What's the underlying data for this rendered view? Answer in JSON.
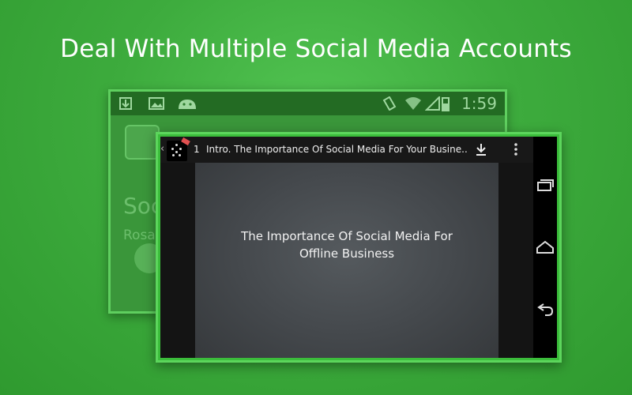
{
  "headline": "Deal With Multiple Social Media Accounts",
  "back_phone": {
    "status_icons": [
      "download-icon",
      "image-icon",
      "android-icon",
      "rotate-icon",
      "wifi-icon",
      "signal-icon",
      "battery-icon"
    ],
    "clock": "1:59",
    "bg_title": "Soc",
    "bg_subtitle": "Rosa"
  },
  "player": {
    "episode_number": "1",
    "episode_title": "Intro. The Importance Of Social Media For Your Busine...",
    "slide_text_line1": "The Importance Of Social Media For",
    "slide_text_line2": "Offline Business",
    "icons": [
      "back-icon",
      "download-icon",
      "overflow-menu-icon"
    ]
  },
  "nav_bar": {
    "icons": [
      "recent-apps-icon",
      "home-icon",
      "back-icon"
    ]
  },
  "colors": {
    "background": "#3dab3d",
    "frame_border": "#5cd65c",
    "headline_text": "#ffffff"
  }
}
